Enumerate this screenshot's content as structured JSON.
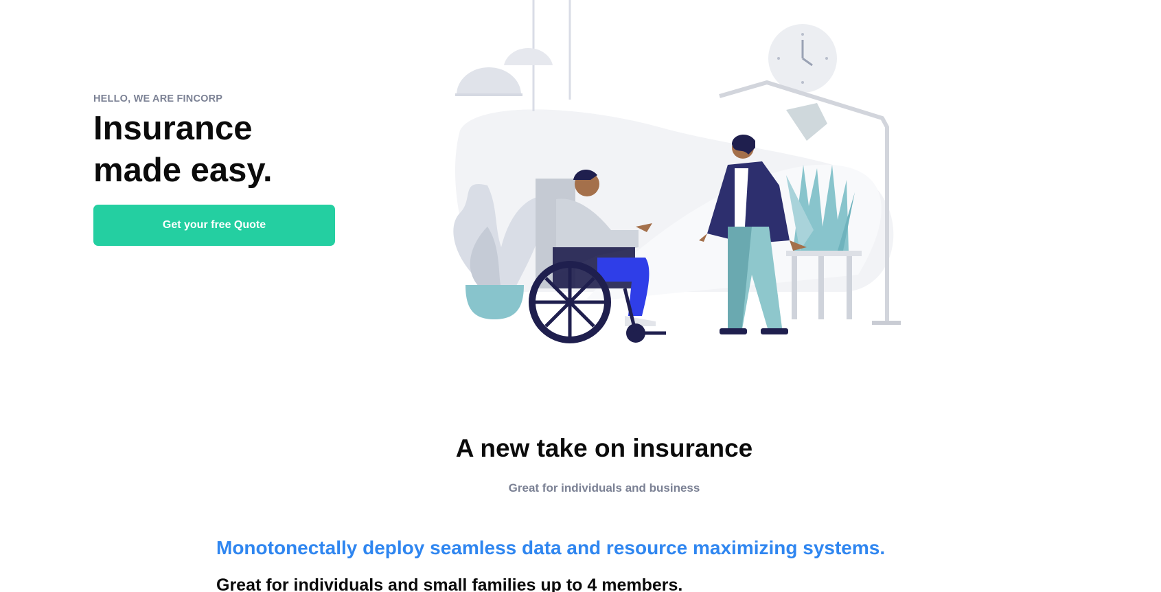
{
  "hero": {
    "eyebrow": "HELLO, WE ARE FINCORP",
    "title_line1": "Insurance",
    "title_line2": "made easy.",
    "cta_label": "Get your free Quote"
  },
  "illustration": {
    "icons": [
      "pendant-lamp-icon",
      "wall-clock-icon",
      "floor-lamp-icon",
      "potted-plant-icon",
      "wheelchair-person-icon",
      "standing-person-icon"
    ]
  },
  "section": {
    "title": "A new take on insurance",
    "subtitle": "Great for individuals and business"
  },
  "feature": {
    "headline": "Monotonectally deploy seamless data and resource maximizing systems.",
    "text": "Great for individuals and small families up to 4 members."
  },
  "colors": {
    "accent": "#24cfa1",
    "link_blue": "#2f86f0",
    "muted": "#7b8194",
    "navy": "#2d2f6e"
  }
}
